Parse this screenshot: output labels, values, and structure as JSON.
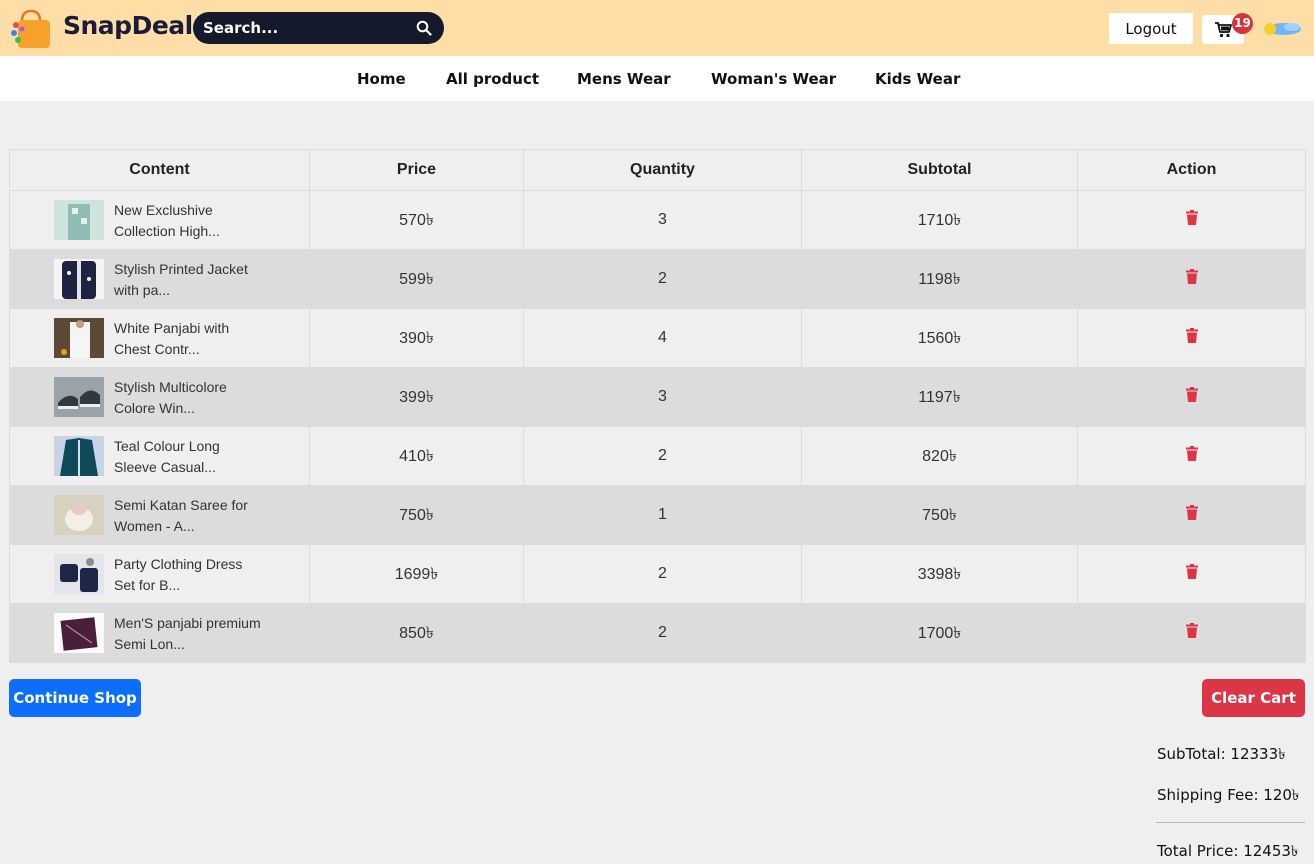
{
  "header": {
    "brand": "SnapDeal",
    "search_placeholder": "Search...",
    "logout_label": "Logout",
    "cart_count": "19",
    "colors": {
      "header_bg": "#ffdda6",
      "search_bg": "#141a2c",
      "badge": "#d8323f"
    }
  },
  "nav": [
    "Home",
    "All product",
    "Mens Wear",
    "Woman's Wear",
    "Kids Wear"
  ],
  "table": {
    "headers": [
      "Content",
      "Price",
      "Quantity",
      "Subtotal",
      "Action"
    ],
    "rows": [
      {
        "name_line1": "New Exclushive",
        "name_line2": "Collection High...",
        "price": "570৳",
        "quantity": "3",
        "subtotal": "1710৳",
        "thumb": "kurta-thumbnail"
      },
      {
        "name_line1": "Stylish Printed Jacket",
        "name_line2": "with pa...",
        "price": "599৳",
        "quantity": "2",
        "subtotal": "1198৳",
        "thumb": "jacket-thumbnail"
      },
      {
        "name_line1": "White Panjabi with",
        "name_line2": "Chest Contr...",
        "price": "390৳",
        "quantity": "4",
        "subtotal": "1560৳",
        "thumb": "panjabi-thumbnail"
      },
      {
        "name_line1": "Stylish Multicolore",
        "name_line2": "Colore Win...",
        "price": "399৳",
        "quantity": "3",
        "subtotal": "1197৳",
        "thumb": "sneaker-thumbnail"
      },
      {
        "name_line1": "Teal Colour Long",
        "name_line2": "Sleeve Casual...",
        "price": "410৳",
        "quantity": "2",
        "subtotal": "820৳",
        "thumb": "shirt-thumbnail"
      },
      {
        "name_line1": "Semi Katan Saree for",
        "name_line2": "Women - A...",
        "price": "750৳",
        "quantity": "1",
        "subtotal": "750৳",
        "thumb": "saree-thumbnail"
      },
      {
        "name_line1": "Party Clothing Dress",
        "name_line2": "Set for B...",
        "price": "1699৳",
        "quantity": "2",
        "subtotal": "3398৳",
        "thumb": "dress-set-thumbnail"
      },
      {
        "name_line1": "Men'S panjabi premium",
        "name_line2": "Semi Lon...",
        "price": "850৳",
        "quantity": "2",
        "subtotal": "1700৳",
        "thumb": "premium-panjabi-thumbnail"
      }
    ]
  },
  "actions": {
    "continue_label": "Continue Shop",
    "clear_label": "Clear Cart"
  },
  "summary": {
    "subtotal": "SubTotal: 12333৳",
    "shipping": "Shipping Fee: 120৳",
    "total": "Total Price: 12453৳"
  },
  "colors": {
    "primary": "#0d6efd",
    "danger": "#dc3545",
    "row_alt": "#dcdcdc",
    "page_bg": "#efefef"
  }
}
